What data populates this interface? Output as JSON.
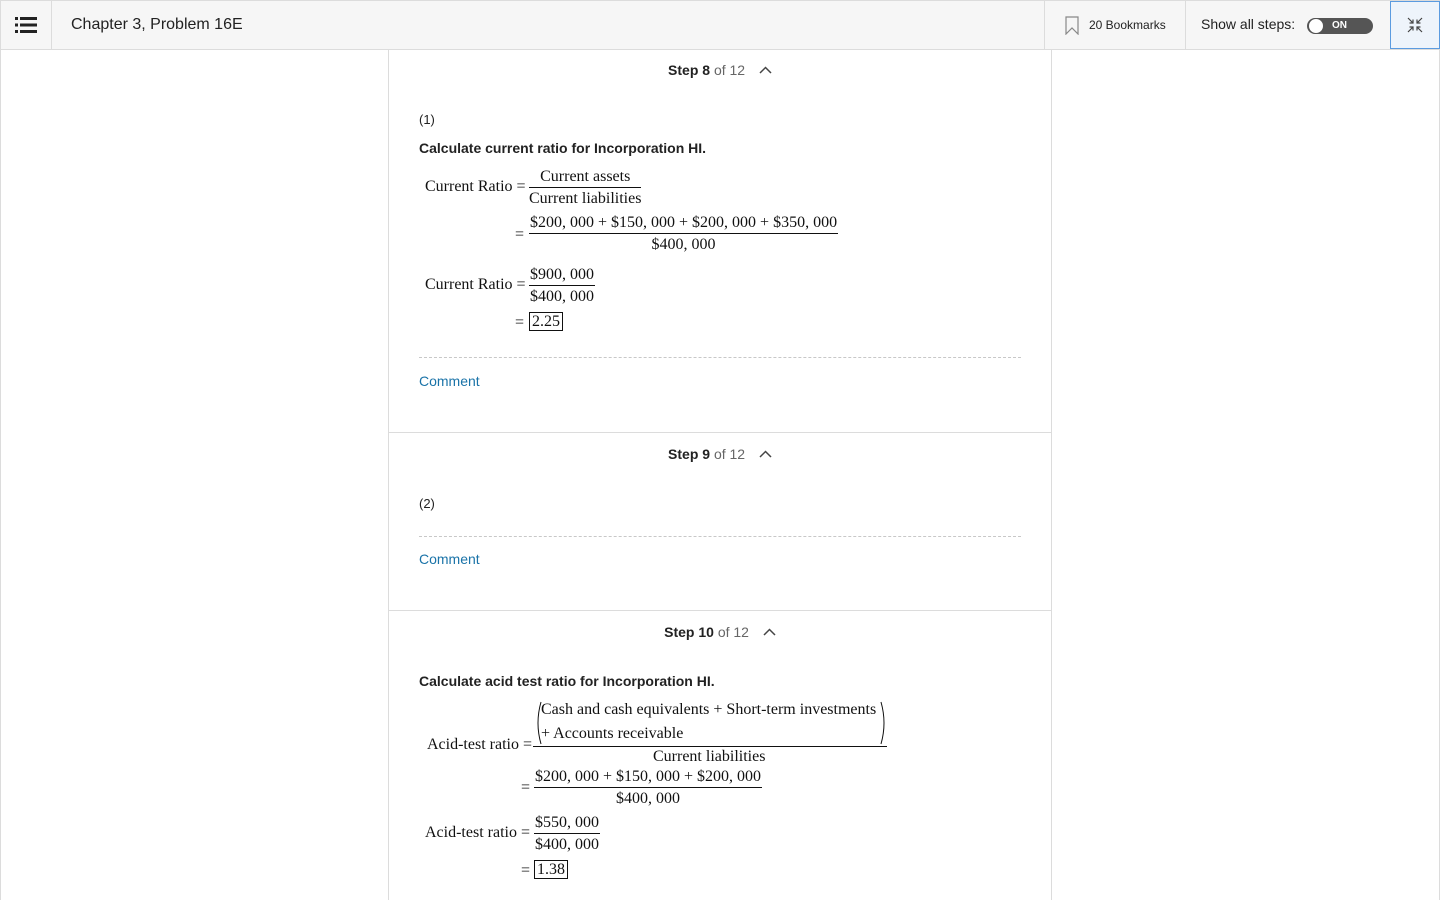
{
  "header": {
    "chapter_title": "Chapter 3, Problem 16E",
    "bookmarks_label": "20 Bookmarks",
    "show_all_label": "Show all steps:",
    "toggle_label": "ON"
  },
  "steps": [
    {
      "number": "Step 8",
      "of": "of 12",
      "part": "(1)",
      "heading": "Calculate current ratio for Incorporation HI.",
      "math": {
        "lhs1": "Current Ratio =",
        "num1": "Current assets",
        "den1": "Current liabilities",
        "eq": "=",
        "num2": "$200, 000 + $150, 000 + $200, 000 + $350, 000",
        "den2": "$400, 000",
        "lhs3": "Current Ratio =",
        "num3": "$900, 000",
        "den3": "$400, 000",
        "result": "2.25"
      },
      "comment": "Comment"
    },
    {
      "number": "Step 9",
      "of": "of 12",
      "part": "(2)",
      "comment": "Comment"
    },
    {
      "number": "Step 10",
      "of": "of 12",
      "heading": "Calculate acid test ratio for Incorporation HI.",
      "math": {
        "lhs1": "Acid-test ratio =",
        "num1a": "Cash and cash equivalents  + Short-term investments",
        "num1b": "+ Accounts receivable",
        "den1": "Current liabilities",
        "eq": "=",
        "num2": "$200, 000 + $150, 000 + $200, 000",
        "den2": "$400, 000",
        "lhs3": "Acid-test ratio =",
        "num3": "$550, 000",
        "den3": "$400, 000",
        "result": "1.38"
      }
    }
  ]
}
